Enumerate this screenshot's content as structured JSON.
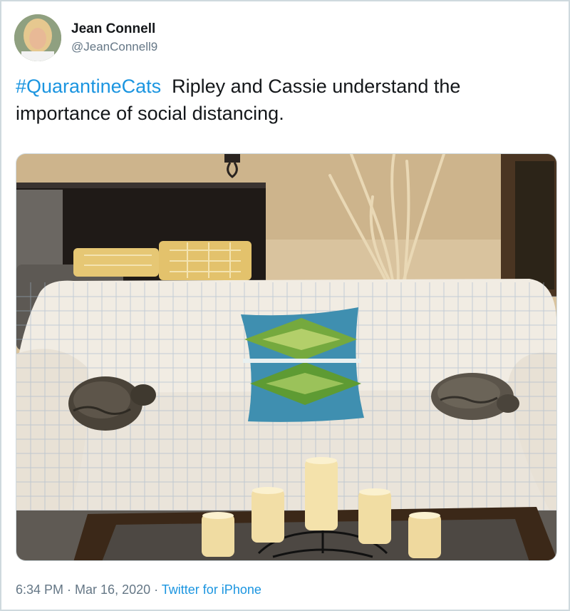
{
  "user": {
    "display_name": "Jean Connell",
    "handle": "@JeanConnell9"
  },
  "tweet": {
    "hashtag": "#QuarantineCats",
    "text": "  Ripley and Cassie understand the importance of social distancing."
  },
  "meta": {
    "time": "6:34 PM",
    "separator1": " · ",
    "date": "Mar 16, 2020",
    "separator2": " · ",
    "source": "Twitter for iPhone"
  },
  "colors": {
    "link": "#1b95e0",
    "text": "#14171a",
    "secondary": "#657786"
  }
}
